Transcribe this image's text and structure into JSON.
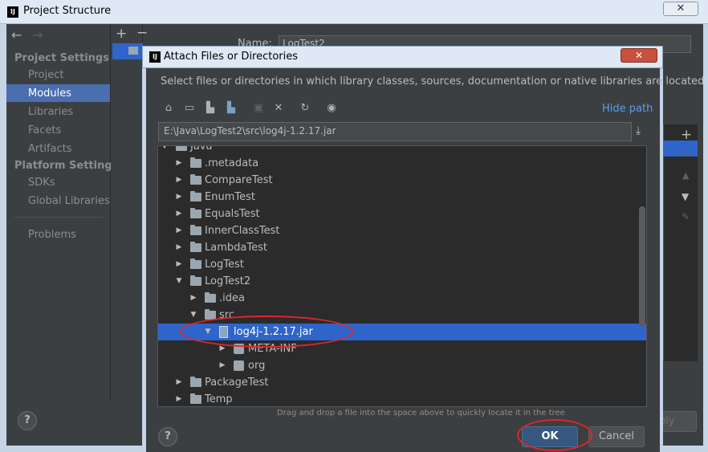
{
  "outer": {
    "title": "Project Structure",
    "logo": "IJ",
    "close": "✕",
    "name_label": "Name:",
    "name_value": "LogTest2",
    "sections": [
      {
        "title": "Project Settings",
        "items": [
          "Project",
          "Modules",
          "Libraries",
          "Facets",
          "Artifacts"
        ]
      },
      {
        "title": "Platform Settings",
        "items": [
          "SDKs",
          "Global Libraries"
        ]
      }
    ],
    "problems": "Problems",
    "help": "?",
    "apply_partial": "ply",
    "selected_item": "Modules"
  },
  "dialog": {
    "title": "Attach Files or Directories",
    "logo": "IJ",
    "close": "✕",
    "description": "Select files or directories in which library classes, sources, documentation or native libraries are located",
    "hide_path": "Hide path",
    "path": "E:\\Java\\LogTest2\\src\\log4j-1.2.17.jar",
    "hint": "Drag and drop a file into the space above to quickly locate it in the tree",
    "ok": "OK",
    "cancel": "Cancel",
    "help": "?",
    "tree": [
      {
        "label": "Java",
        "depth": 0,
        "expanded": true,
        "icon": "folder-icon"
      },
      {
        "label": ".metadata",
        "depth": 1,
        "expanded": false,
        "icon": "folder-icon"
      },
      {
        "label": "CompareTest",
        "depth": 1,
        "expanded": false,
        "icon": "folder-icon"
      },
      {
        "label": "EnumTest",
        "depth": 1,
        "expanded": false,
        "icon": "folder-icon"
      },
      {
        "label": "EqualsTest",
        "depth": 1,
        "expanded": false,
        "icon": "folder-icon"
      },
      {
        "label": "InnerClassTest",
        "depth": 1,
        "expanded": false,
        "icon": "folder-icon"
      },
      {
        "label": "LambdaTest",
        "depth": 1,
        "expanded": false,
        "icon": "folder-icon"
      },
      {
        "label": "LogTest",
        "depth": 1,
        "expanded": false,
        "icon": "folder-icon"
      },
      {
        "label": "LogTest2",
        "depth": 1,
        "expanded": true,
        "icon": "folder-icon"
      },
      {
        "label": ".idea",
        "depth": 2,
        "expanded": false,
        "icon": "folder-icon"
      },
      {
        "label": "src",
        "depth": 2,
        "expanded": true,
        "icon": "folder-icon"
      },
      {
        "label": "log4j-1.2.17.jar",
        "depth": 3,
        "expanded": true,
        "icon": "jar-icon",
        "selected": true
      },
      {
        "label": "META-INF",
        "depth": 4,
        "expanded": false,
        "icon": "package-icon"
      },
      {
        "label": "org",
        "depth": 4,
        "expanded": false,
        "icon": "package-icon"
      },
      {
        "label": "PackageTest",
        "depth": 1,
        "expanded": false,
        "icon": "folder-icon"
      },
      {
        "label": "Temp",
        "depth": 1,
        "expanded": false,
        "icon": "folder-icon"
      }
    ]
  },
  "colors": {
    "selection": "#2f65ca",
    "annotation": "#e0262a",
    "ok_button": "#365880"
  }
}
